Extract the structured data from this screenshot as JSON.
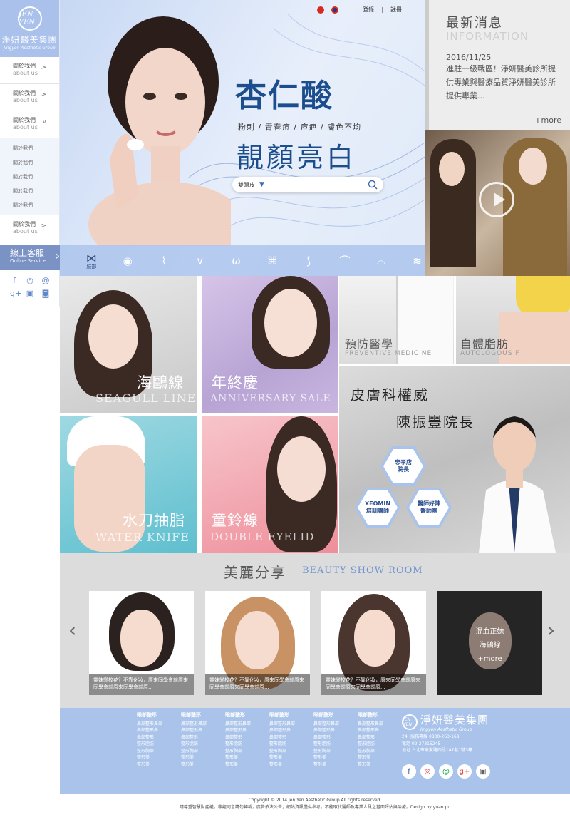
{
  "brand": {
    "name": "淨妍醫美集團",
    "sub": "Jingyen Aesthetic Group",
    "mark": "JEN YEN"
  },
  "sidebar": {
    "items": [
      {
        "label": "關於我們",
        "en": "about us",
        "arrow": ">"
      },
      {
        "label": "關於我們",
        "en": "about us",
        "arrow": ">"
      },
      {
        "label": "關於我們",
        "en": "about us",
        "arrow": "v"
      }
    ],
    "sub_items": [
      "關於我們",
      "關於我們",
      "關於我們",
      "關於我們",
      "關於我們"
    ],
    "last_item": {
      "label": "關於我們",
      "en": "about us",
      "arrow": ">"
    },
    "online_service": {
      "zh": "線上客服",
      "en": "Online Service"
    }
  },
  "topbar": {
    "login": "登錄",
    "register": "註冊",
    "sep": "|"
  },
  "hero": {
    "title": "杏仁酸",
    "tags": "粉刺 / 青春痘 / 痘疤 / 膚色不均",
    "subtitle": "靚顏亮白",
    "search_value": "雙眼皮",
    "icons": [
      "face-icon",
      "eye-icon",
      "nose-icon",
      "chin-icon",
      "breast-icon",
      "body-icon",
      "leg-icon",
      "arm-icon",
      "hip-icon",
      "water-icon"
    ],
    "active_label": "臉部"
  },
  "news": {
    "title": "最新消息",
    "en": "INFORMATION",
    "date": "2016/11/25",
    "body": "進駐一級戰區！淨妍醫美診所提供專業與醫療品質淨妍醫美診所提供專業...",
    "more": "+more"
  },
  "tiles": {
    "seagull": {
      "zh": "海鷗線",
      "en": "SEAGULL LINE"
    },
    "anniv": {
      "zh": "年終慶",
      "en": "ANNIVERSARY SALE"
    },
    "water": {
      "zh": "水刀抽脂",
      "en": "WATER KNIFE"
    },
    "bell": {
      "zh": "童鈴線",
      "en": "DOUBLE EYELID"
    },
    "prev": {
      "zh": "預防醫學",
      "en": "PREVENTIVE MEDICINE"
    },
    "auto": {
      "zh": "自體脂肪",
      "en": "AUTOLOGOUS F"
    }
  },
  "doctor": {
    "line1": "皮膚科權威",
    "line2": "陳振豐院長",
    "hex1": [
      "忠孝店",
      "院長"
    ],
    "hex2": [
      "XEOMIN",
      "培訓講師"
    ],
    "hex3": [
      "醫師好辣",
      "醫師團"
    ]
  },
  "beauty": {
    "title": "美麗分享",
    "en": "BEAUTY SHOW ROOM",
    "cards": [
      {
        "caption": "靈妹變校花？不靠化妝，原來同學會前原來同學會前原來同學會前原..."
      },
      {
        "caption": "靈妹變校花？不靠化妝，原來同學會前原來同學會前原來同學會前原..."
      },
      {
        "caption": "靈妹變校花？不靠化妝，原來同學會前原來同學會前原來同學會前原..."
      }
    ],
    "featured": {
      "line1": "混血正妹",
      "line2": "海鷗線",
      "more": "+more"
    }
  },
  "footer": {
    "columns": [
      {
        "head": "眼部整形",
        "items": [
          "鼻部整形鼻部",
          "鼻部整形鼻",
          "鼻部整形",
          "整形脂肪",
          "整形胸部",
          "整形美",
          "整形美"
        ]
      },
      {
        "head": "眼部整形",
        "items": [
          "鼻部整形鼻部",
          "鼻部整形鼻",
          "鼻部整形",
          "整形脂肪",
          "整形胸部",
          "整形美",
          "整形美"
        ]
      },
      {
        "head": "眼部整形",
        "items": [
          "鼻部整形鼻部",
          "鼻部整形鼻",
          "鼻部整形",
          "整形脂肪",
          "整形胸部",
          "整形美",
          "整形美"
        ]
      },
      {
        "head": "眼部整形",
        "items": [
          "鼻部整形鼻部",
          "鼻部整形鼻",
          "鼻部整形",
          "整形脂肪",
          "整形胸部",
          "整形美",
          "整形美"
        ]
      },
      {
        "head": "眼部整形",
        "items": [
          "鼻部整形鼻部",
          "鼻部整形鼻",
          "鼻部整形",
          "整形脂肪",
          "整形胸部",
          "整形美",
          "整形美"
        ]
      },
      {
        "head": "眼部整形",
        "items": [
          "鼻部整形鼻部",
          "鼻部整形鼻",
          "鼻部整形",
          "整形脂肪",
          "整形胸部",
          "整形美",
          "整形美"
        ]
      }
    ],
    "hotline": "24H服務專線 0800-263-168",
    "phone": "電話 02-27315245",
    "address": "地址 台北市東東路四段147巷1號3樓",
    "social": [
      "facebook-icon",
      "weibo-icon",
      "line-icon",
      "google-plus-icon",
      "instagram-icon"
    ]
  },
  "copyright": "Copyright © 2014.Jen Yen Aesthetic Group All rights reserved.",
  "disclaimer": "請尊重智慧財產權，非經同意請勿轉載，廣告依法公告；網站資訊僅供參考，不能取代醫師及專業人員之當面評估與治療。Design by yuan pu",
  "colors": {
    "brand_blue": "#a9c3ea",
    "title_navy": "#1c4d8c",
    "cs_blue": "#7b93c4"
  }
}
